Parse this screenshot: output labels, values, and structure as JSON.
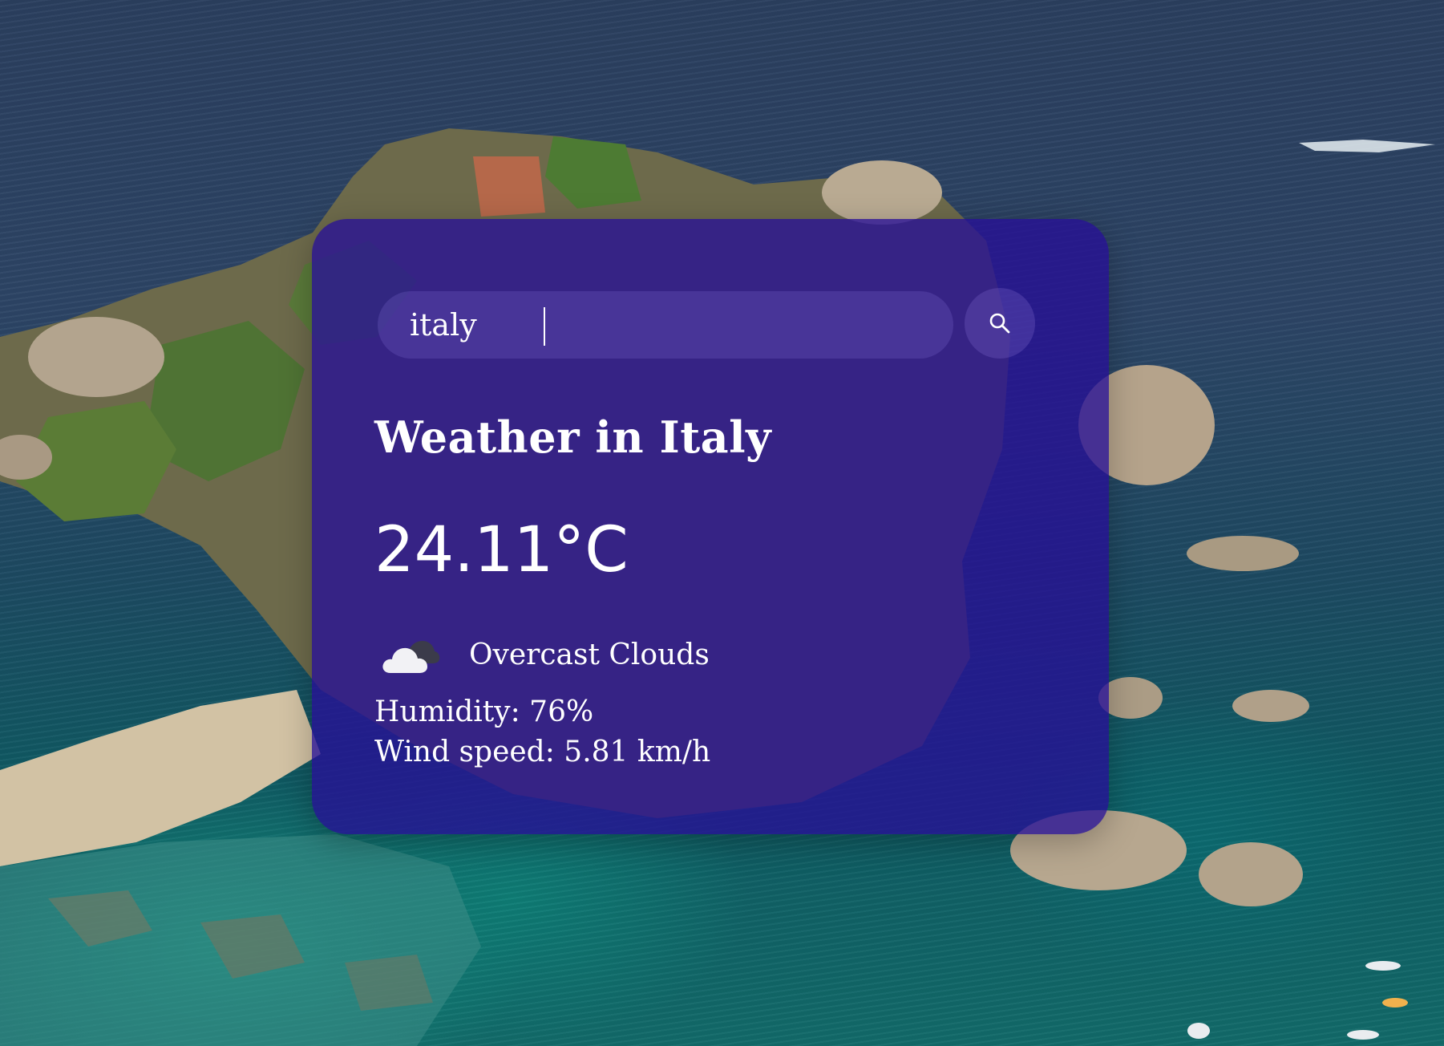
{
  "search": {
    "value": "italy",
    "icon": "search-icon"
  },
  "weather": {
    "title": "Weather in Italy",
    "temperature": "24.11°C",
    "condition_icon": "overcast-clouds-icon",
    "condition": "Overcast Clouds",
    "humidity": "Humidity: 76%",
    "wind": "Wind speed: 5.81 km/h"
  },
  "colors": {
    "card_background": "#260f96",
    "text": "#ffffff",
    "search_field": "#7864c8"
  }
}
